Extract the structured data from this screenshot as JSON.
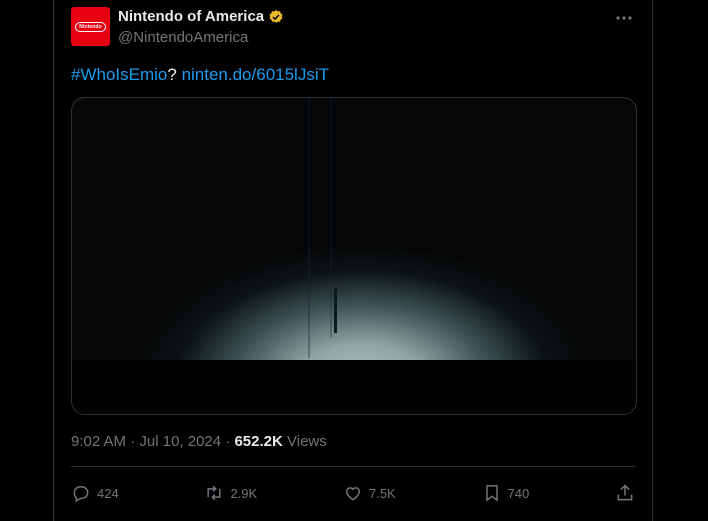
{
  "post": {
    "author_name": "Nintendo of America",
    "handle": "@NintendoAmerica",
    "avatar_text": "Nintendo",
    "text_hashtag": "#WhoIsEmio",
    "text_mid": "? ",
    "text_link": "ninten.do/6015lJsiT",
    "time": "9:02 AM",
    "sep": " · ",
    "date": "Jul 10, 2024",
    "views_count": "652.2K",
    "views_label": "Views"
  },
  "actions": {
    "replies": "424",
    "reposts": "2.9K",
    "likes": "7.5K",
    "bookmarks": "740"
  },
  "colors": {
    "accent": "#1d9bf0",
    "brand": "#e60012",
    "verified": "#e8b82d"
  }
}
